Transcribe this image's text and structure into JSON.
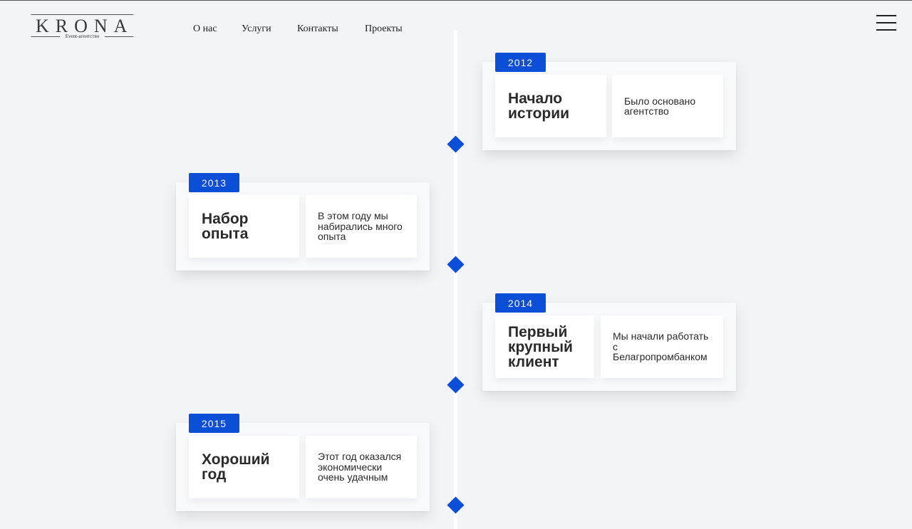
{
  "logo": {
    "name": "KRONA",
    "subtitle": "Event-агентство"
  },
  "nav": {
    "items": [
      {
        "label": "О нас"
      },
      {
        "label": "Услуги"
      },
      {
        "label": "Контакты"
      },
      {
        "label": "Проекты"
      }
    ]
  },
  "menu_icon": "hamburger-menu-icon",
  "accent_color": "#0b4fd6",
  "timeline": {
    "events": [
      {
        "year": "2012",
        "title": "Начало истории",
        "description": "Было основано агентство"
      },
      {
        "year": "2013",
        "title": "Набор опыта",
        "description": "В этом году мы набирались много опыта"
      },
      {
        "year": "2014",
        "title": "Первый крупный клиент",
        "description": "Мы начали работать с Белагропромбанком"
      },
      {
        "year": "2015",
        "title": "Хороший год",
        "description": "Этот год оказался экономически очень удачным"
      }
    ]
  }
}
